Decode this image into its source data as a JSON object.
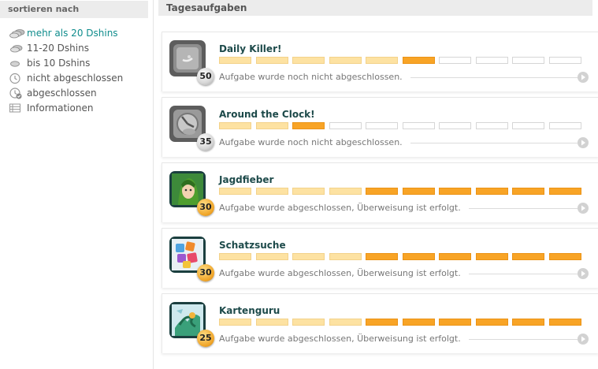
{
  "sidebar": {
    "title": "sortieren nach",
    "items": [
      {
        "label": "mehr als 20 Dshins",
        "icon": "coin-stack-large-icon",
        "active": true
      },
      {
        "label": "11-20 Dshins",
        "icon": "coin-stack-medium-icon",
        "active": false
      },
      {
        "label": "bis 10 Dshins",
        "icon": "coin-small-icon",
        "active": false
      },
      {
        "label": "nicht abgeschlossen",
        "icon": "clock-icon",
        "active": false
      },
      {
        "label": "abgeschlossen",
        "icon": "clock-check-icon",
        "active": false
      },
      {
        "label": "Informationen",
        "icon": "list-icon",
        "active": false
      }
    ]
  },
  "main": {
    "title": "Tagesaufgaben",
    "tasks": [
      {
        "title": "Daily Killer!",
        "reward": "50",
        "status": "Aufgabe wurde noch nicht abgeschlossen.",
        "completed": false,
        "progress_filled": 6,
        "progress_total": 10,
        "icon": "daily-killer-icon"
      },
      {
        "title": "Around the Clock!",
        "reward": "35",
        "status": "Aufgabe wurde noch nicht abgeschlossen.",
        "completed": false,
        "progress_filled": 3,
        "progress_total": 10,
        "icon": "around-the-clock-icon"
      },
      {
        "title": "Jagdfieber",
        "reward": "30",
        "status": "Aufgabe wurde abgeschlossen, Überweisung ist erfolgt.",
        "completed": true,
        "progress_filled": 10,
        "progress_total": 10,
        "icon": "jagdfieber-icon"
      },
      {
        "title": "Schatzsuche",
        "reward": "30",
        "status": "Aufgabe wurde abgeschlossen, Überweisung ist erfolgt.",
        "completed": true,
        "progress_filled": 10,
        "progress_total": 10,
        "icon": "schatzsuche-icon"
      },
      {
        "title": "Kartenguru",
        "reward": "25",
        "status": "Aufgabe wurde abgeschlossen, Überweisung ist erfolgt.",
        "completed": true,
        "progress_filled": 10,
        "progress_total": 10,
        "icon": "kartenguru-icon"
      }
    ]
  },
  "colors": {
    "accent": "#0f8c8c",
    "title": "#1d4a4a",
    "progress_light": "#fde2a2",
    "progress_dark": "#f8a426",
    "header_bg": "#ececec"
  }
}
